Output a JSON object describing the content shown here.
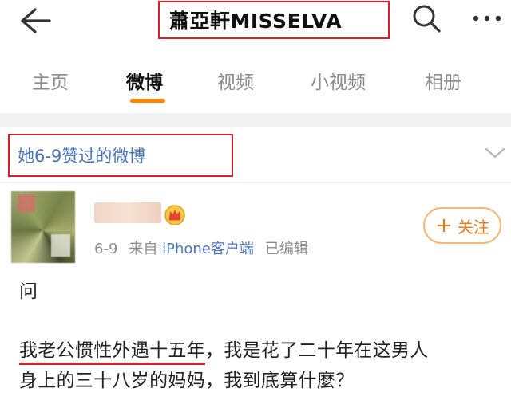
{
  "header": {
    "title": "蕭亞軒MISSELVA",
    "icons": [
      "back-arrow-icon",
      "search-icon",
      "more-icon"
    ]
  },
  "tabs": [
    {
      "label": "主页",
      "active": false
    },
    {
      "label": "微博",
      "active": true
    },
    {
      "label": "视频",
      "active": false
    },
    {
      "label": "小视频",
      "active": false
    },
    {
      "label": "相册",
      "active": false
    }
  ],
  "filter": {
    "label": "她6-9赞过的微博"
  },
  "post": {
    "date": "6-9",
    "source_prefix": "来自",
    "source_app": "iPhone客户端",
    "edited_label": "已编辑",
    "follow_plus": "+",
    "follow_label": "关注",
    "question": "问",
    "line1_underlined": "我老公惯性外遇十五年",
    "line1_rest": "，我是花了二十年在这男人",
    "line2": "身上的三十八岁的妈妈，我到底算什麼？"
  },
  "colors": {
    "accent": "#ff8200",
    "link": "#4b74b8",
    "highlight_border": "#d81e2a",
    "muted": "#8c8c8c"
  }
}
